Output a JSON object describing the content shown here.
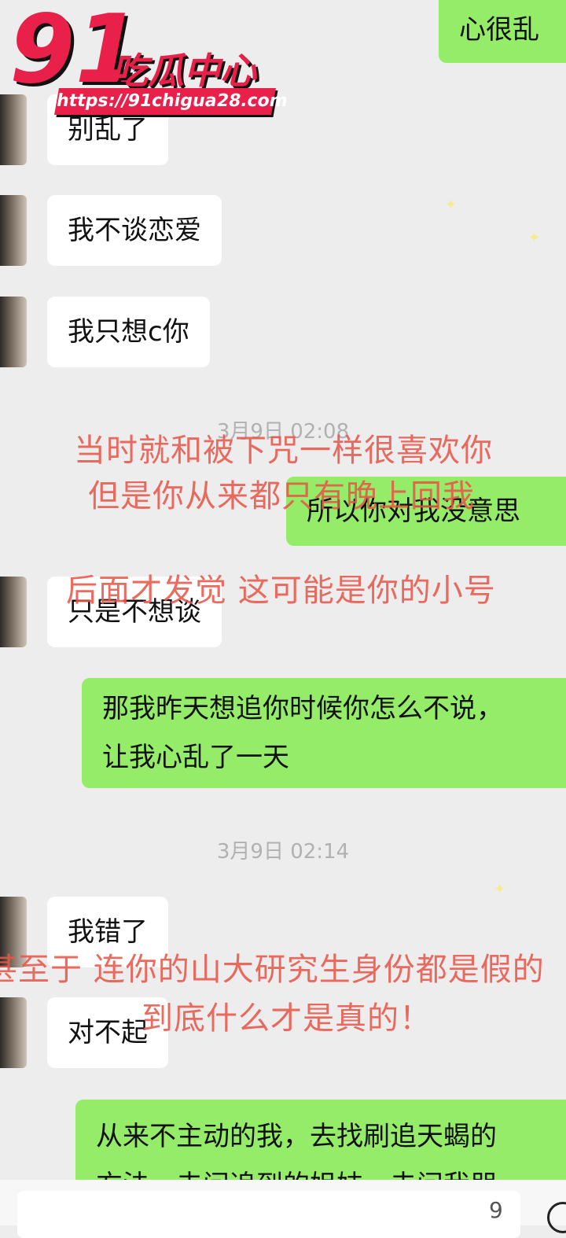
{
  "watermark": {
    "logo_number": "91",
    "logo_text": "吃瓜中心",
    "url": "https://91chigua28.com"
  },
  "messages": [
    {
      "side": "right",
      "text": "心很乱"
    },
    {
      "side": "left",
      "text": "别乱了"
    },
    {
      "side": "left",
      "text": "我不谈恋爱"
    },
    {
      "side": "left",
      "text": "我只想c你"
    },
    {
      "side": "right",
      "text": "所以你对我没意思"
    },
    {
      "side": "left",
      "text": "只是不想谈"
    },
    {
      "side": "right",
      "lines": [
        "那我昨天想追你时候你怎么不说，",
        "让我心乱了一天"
      ]
    },
    {
      "side": "left",
      "text": "我错了"
    },
    {
      "side": "left",
      "text": "对不起"
    },
    {
      "side": "right",
      "lines": [
        "从来不主动的我，去找刷追天蝎的",
        "方法，去问追到的姐妹，去问我朋"
      ]
    }
  ],
  "timestamps": [
    "3月9日 02:08",
    "3月9日 02:14"
  ],
  "overlay_text": [
    "当时就和被下咒一样很喜欢你",
    "但是你从来都只有晚上回我",
    "后面才发觉 这可能是你的小号",
    "甚至于  连你的山大研究生身份都是假的",
    "到底什么才是真的！"
  ],
  "input": {
    "hint": "9"
  },
  "colors": {
    "background": "#ededed",
    "bubble_right": "#95ec69",
    "bubble_left": "#ffffff",
    "overlay": "#e8574a",
    "logo": "#e8204a"
  }
}
